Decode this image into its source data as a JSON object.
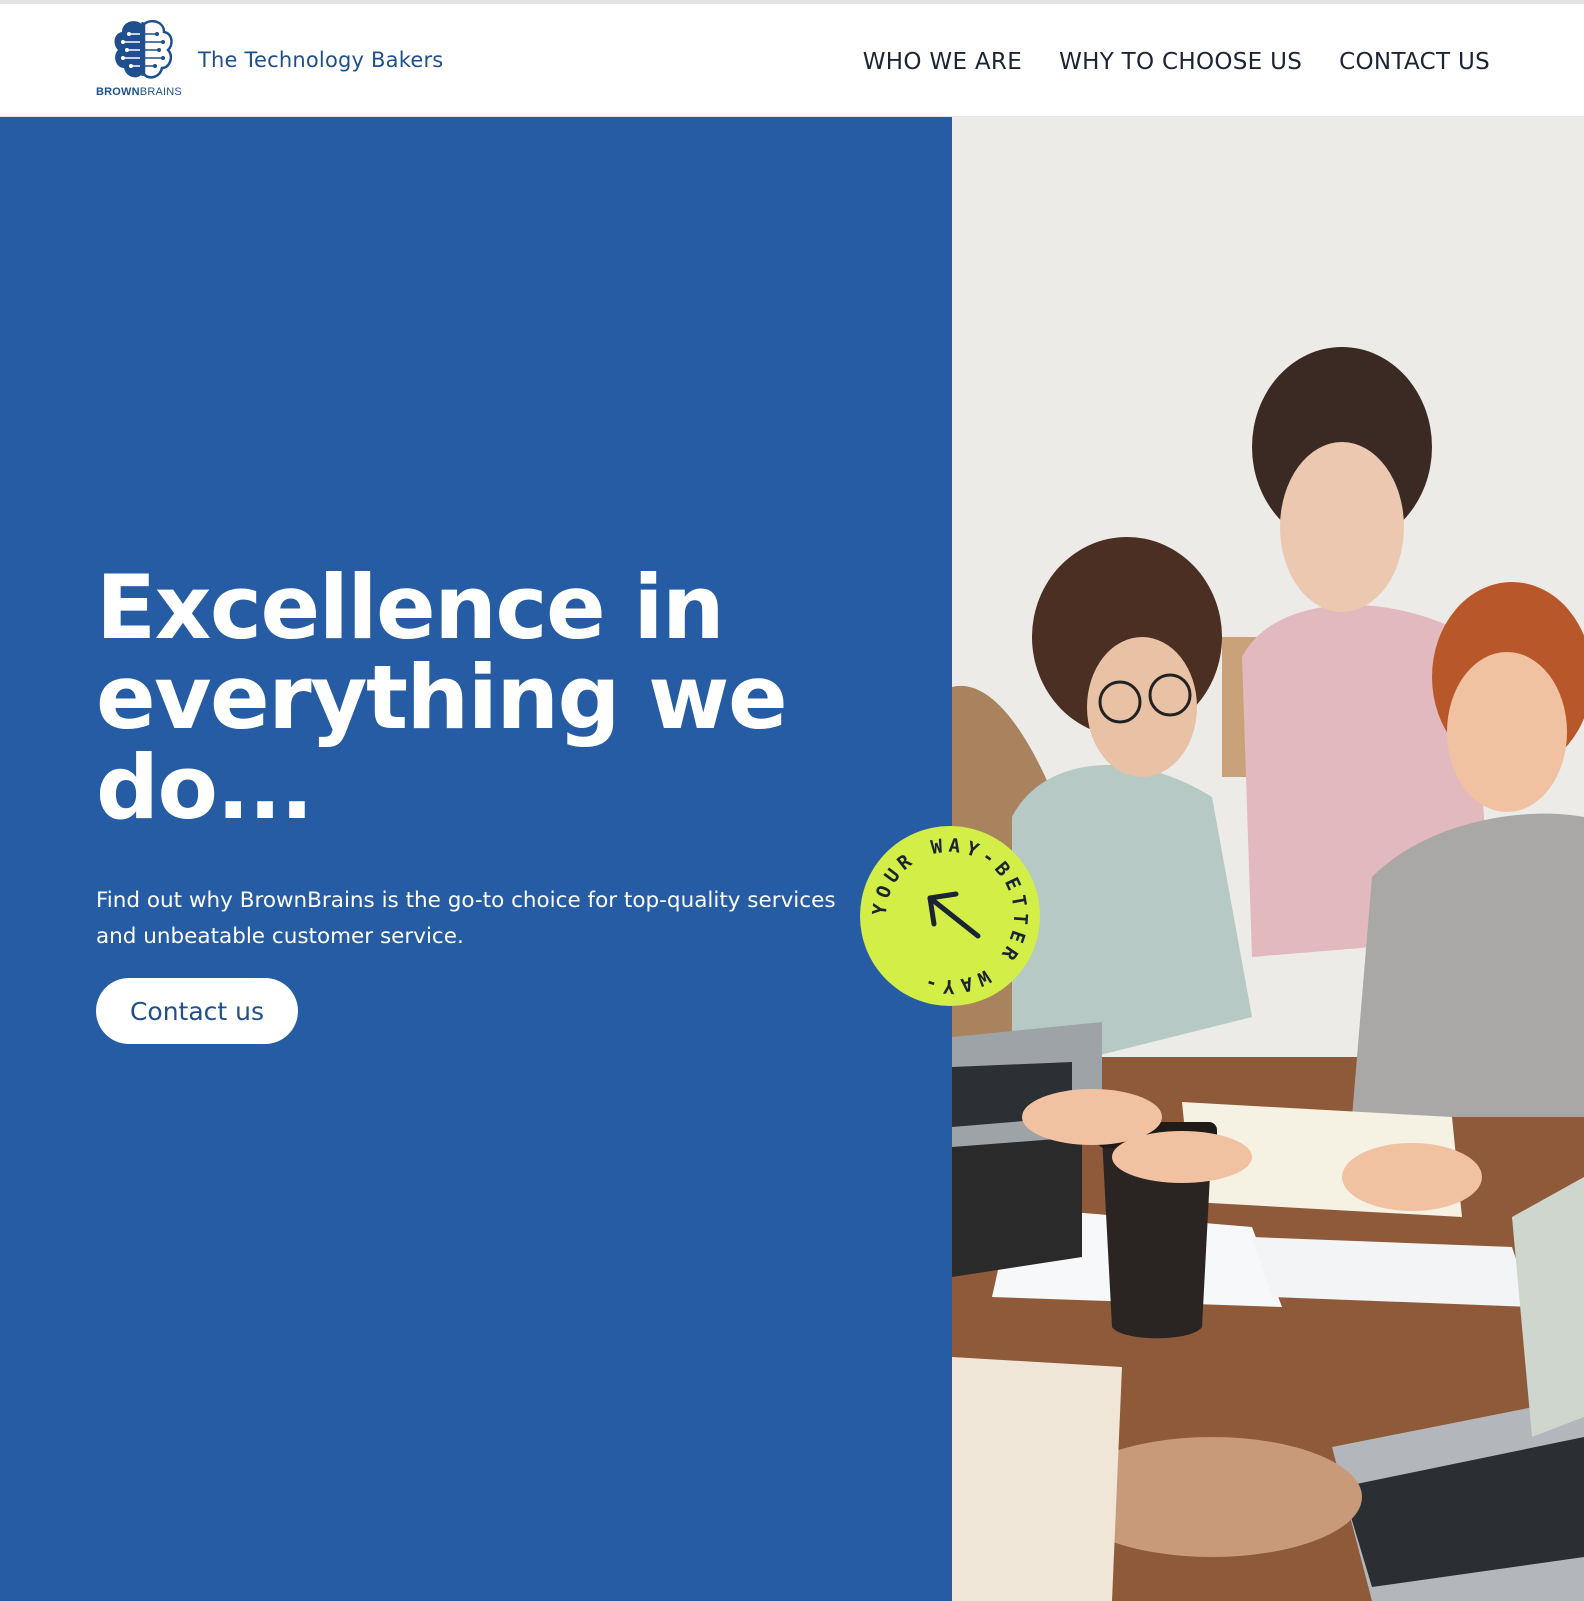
{
  "header": {
    "logo": {
      "wordmark_bold": "BROWN",
      "wordmark_light": "BRAINS"
    },
    "tagline": "The Technology Bakers",
    "nav": [
      {
        "label": "WHO WE ARE"
      },
      {
        "label": "WHY TO CHOOSE US"
      },
      {
        "label": "CONTACT US"
      }
    ]
  },
  "hero": {
    "headline_line1": "Excellence in",
    "headline_line2": "everything we",
    "headline_line3": "do...",
    "subtext_line1": "Find out why BrownBrains is the go-to choice for top-quality services",
    "subtext_line2": "and unbeatable customer service.",
    "cta_label": "Contact us",
    "badge_text": "YOUR WAY-BETTER WAY-",
    "photo": "team-meeting-photo"
  },
  "colors": {
    "brand_blue": "#255ca3",
    "logo_blue": "#1f4f8f",
    "badge_green": "#d2ee47",
    "text_dark": "#1b2433"
  }
}
